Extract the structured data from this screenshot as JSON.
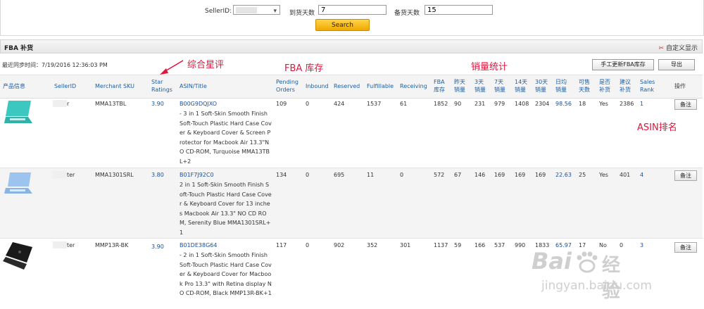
{
  "search": {
    "seller_label": "SellerID:",
    "arrival_label": "到货天数",
    "arrival_value": "7",
    "stock_label": "备货天数",
    "stock_value": "15",
    "search_label": "Search"
  },
  "panel": {
    "title": "FBA 补货",
    "custom_display": "自定义显示",
    "sync_time": "最近同步时间：7/19/2016 12:36:03 PM",
    "update_fba_label": "手工更新FBA库存",
    "export_label": "导出"
  },
  "annotations": {
    "star": "综合星评",
    "fba": "FBA 库存",
    "sales": "销量统计",
    "asin_rank": "ASIN排名"
  },
  "columns": {
    "product": "产品信息",
    "seller": "SellerID",
    "sku": "Merchant SKU",
    "star1": "Star",
    "star2": "Ratings",
    "asin": "ASIN/Title",
    "pending1": "Pending",
    "pending2": "Orders",
    "inbound": "Inbound",
    "reserved": "Reserved",
    "fulfillable": "Fulfillable",
    "receiving": "Receiving",
    "fba1": "FBA",
    "fba2": "库存",
    "yday1": "昨天",
    "yday2": "销量",
    "d3a": "3天",
    "d3b": "销量",
    "d7a": "7天",
    "d7b": "销量",
    "d14a": "14天",
    "d14b": "销量",
    "d30a": "30天",
    "d30b": "销量",
    "avg1": "日均",
    "avg2": "销量",
    "sell1": "可售",
    "sell2": "天数",
    "need1": "是否",
    "need2": "补货",
    "sug1": "建议",
    "sug2": "补货",
    "rank1": "Sales",
    "rank2": "Rank",
    "op": "操作"
  },
  "rows": [
    {
      "seller": "r",
      "sku": "MMA13TBL",
      "star": "3.90",
      "asin": "B00G9DQJXO",
      "title": "- 3 in 1 Soft-Skin Smooth Finish Soft-Touch Plastic Hard Case Cover & Keyboard Cover & Screen Protector for Macbook Air 13.3\"NO CD-ROM, Turquoise MMA13TBL+2",
      "pending": "109",
      "inbound": "0",
      "reserved": "424",
      "fulfillable": "1537",
      "receiving": "61",
      "fba": "1852",
      "yday": "90",
      "d3": "231",
      "d7": "979",
      "d14": "1408",
      "d30": "2304",
      "avg": "98.56",
      "days": "18",
      "need": "Yes",
      "suggest": "2386",
      "rank": "1",
      "note": "备注",
      "product_color": "#3cc8c0"
    },
    {
      "seller": "ter",
      "sku": "MMA1301SRL",
      "star": "3.80",
      "asin": "B01F7J92C0",
      "title": "2 in 1 Soft-Skin Smooth Finish Soft-Touch Plastic Hard Case Cover & Keyboard Cover for 13 inches Macbook Air 13.3\" NO CD ROM, Serenity Blue MMA1301SRL+1",
      "pending": "134",
      "inbound": "0",
      "reserved": "695",
      "fulfillable": "11",
      "receiving": "0",
      "fba": "572",
      "yday": "67",
      "d3": "146",
      "d7": "169",
      "d14": "169",
      "d30": "169",
      "avg": "22.63",
      "days": "25",
      "need": "Yes",
      "suggest": "401",
      "rank": "4",
      "note": "备注",
      "product_color": "#9cc4ee"
    },
    {
      "seller": "ter",
      "sku": "MMP13R-BK",
      "star": "3.90",
      "asin": "B01DE38G64",
      "title": "- 2 in 1 Soft-Skin Smooth Finish Soft-Touch Plastic Hard Case Cover & Keyboard Cover for Macbook Pro 13.3\" with Retina display NO CD-ROM, Black MMP13R-BK+1",
      "pending": "117",
      "inbound": "0",
      "reserved": "902",
      "fulfillable": "352",
      "receiving": "301",
      "fba": "1137",
      "yday": "59",
      "d3": "166",
      "d7": "537",
      "d14": "990",
      "d30": "1833",
      "avg": "65.97",
      "days": "17",
      "need": "No",
      "suggest": "0",
      "rank": "3",
      "note": "备注",
      "product_color": "#1a1a1a"
    }
  ],
  "watermark": {
    "brand": "Bai",
    "brand_cn": "经验",
    "url": "jingyan.baidu.com"
  },
  "colors": {
    "annotation": "#e0143c",
    "link": "#1a4fa0",
    "header_link": "#1a5fa8",
    "search_button": "#f0a900"
  }
}
